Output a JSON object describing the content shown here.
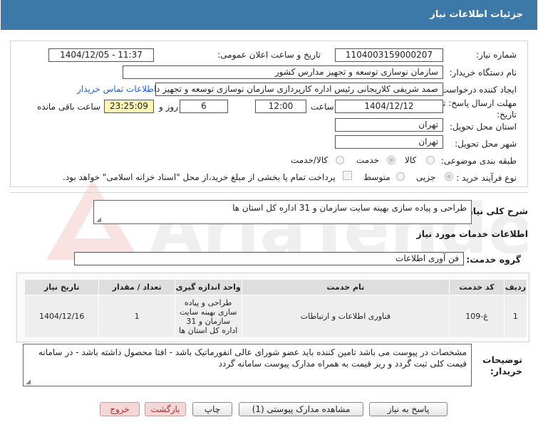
{
  "header": {
    "title": "جزئیات اطلاعات نیاز"
  },
  "fields": {
    "need_number_label": "شماره نیاز:",
    "need_number": "1104003159000207",
    "announce_label": "تاریخ و ساعت اعلان عمومی:",
    "announce_value": "1404/12/05 - 11:37",
    "buyer_org_label": "نام دستگاه خریدار:",
    "buyer_org": "سازمان نوسازی  توسعه و تجهیز مدارس کشور",
    "requester_label": "ایجاد کننده درخواست:",
    "requester": "صمد شریفی کلاریجانی رئیس اداره کارپردازی سازمان نوسازی  توسعه و تجهیز د",
    "contact_link": "اطلاعات تماس خریدار",
    "deadline_label": "مهلت ارسال پاسخ: تا تاریخ:",
    "deadline_date": "1404/12/12",
    "time_label": "ساعت",
    "deadline_time": "12:00",
    "days_value": "6",
    "days_label": "روز و",
    "remaining_time": "23:25:09",
    "remaining_label": "ساعت باقی مانده",
    "province_label": "استان محل تحویل:",
    "province": "تهران",
    "city_label": "شهر محل تحویل:",
    "city": "تهران",
    "category_label": "طبقه بندی موضوعی:",
    "category_options": [
      "کالا",
      "خدمت",
      "کالا/خدمت"
    ],
    "process_label": "نوع فرآیند خرید :",
    "process_options": [
      "جزیی",
      "متوسط"
    ],
    "payment_note": "پرداخت تمام یا بخشی از مبلغ خرید،از محل \"اسناد خزانه اسلامی\" خواهد بود."
  },
  "description": {
    "label": "شرح کلی نیاز:",
    "value": "طراحی و پیاده سازی بهینه سایت سازمان و 31 اداره کل استان ها"
  },
  "services": {
    "section_title": "اطلاعات خدمات مورد نیاز",
    "group_label": "گروه خدمت:",
    "group_value": "فن آوری اطلاعات",
    "columns": [
      "ردیف",
      "کد خدمت",
      "نام خدمت",
      "واحد اندازه گیری",
      "تعداد / مقدار",
      "تاریخ نیاز"
    ],
    "rows": [
      {
        "row": "1",
        "code": "غ-109",
        "name": "فناوری اطلاعات و ارتباطات",
        "unit": "طراحی و پیاده سازی بهینه سایت سازمان و 31 اداره کل استان ها",
        "qty": "1",
        "date": "1404/12/16"
      }
    ]
  },
  "buyer_notes": {
    "label": "توضیحات خریدار:",
    "value": "مشخصات در پیوست می باشد تامین کننده باید عضو شورای عالی انفورماتیک باشد - افتا محصول داشته باشد - در سامانه قیمت کلی ثبت گردد و ریز قیمت به همراه مدارک پیوست سامانه گردد"
  },
  "buttons": {
    "reply": "پاسخ به نیاز",
    "attachments": "مشاهده مدارک پیوستی (1)",
    "print": "چاپ",
    "back": "بازگشت",
    "exit": "خروج"
  },
  "watermark": {
    "text": "AriaTender.net"
  },
  "colors": {
    "header": "#3d79a8",
    "remaining_bg": "#fff6b0",
    "link": "#1c5fd6",
    "exit_text": "#b42a2a"
  }
}
